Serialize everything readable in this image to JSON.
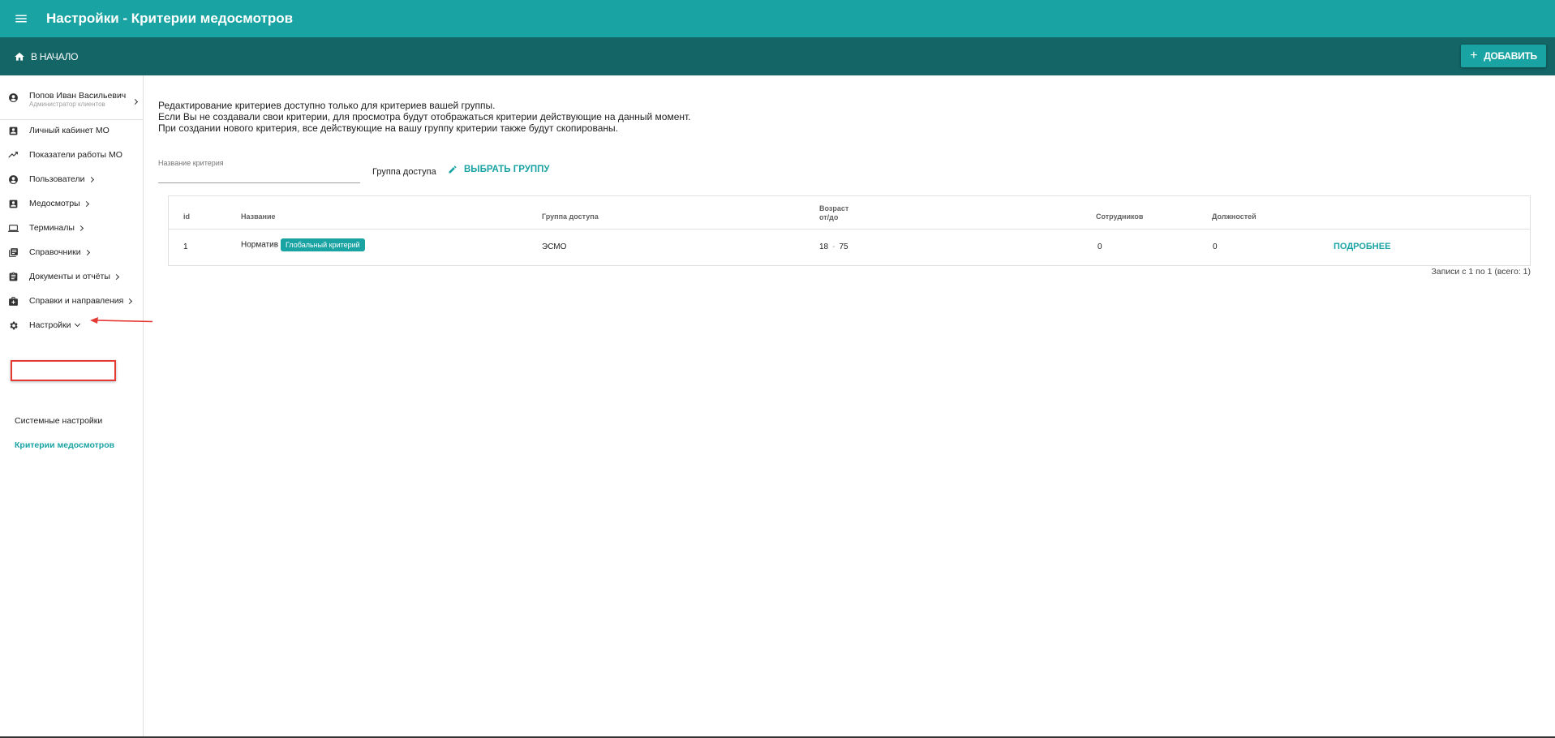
{
  "appbar": {
    "title": "Настройки - Критерии медосмотров"
  },
  "toolbar": {
    "home_label": "В НАЧАЛО",
    "add_label": "ДОБАВИТЬ"
  },
  "sidebar": {
    "user": {
      "name": "Попов Иван Васильевич",
      "role": "Администратор клиентов"
    },
    "items": [
      {
        "label": "Личный кабинет МО",
        "icon": "badge-icon"
      },
      {
        "label": "Показатели работы МО",
        "icon": "trending-icon"
      },
      {
        "label": "Пользователи",
        "icon": "account-icon"
      },
      {
        "label": "Медосмотры",
        "icon": "badge-icon"
      },
      {
        "label": "Терминалы",
        "icon": "laptop-icon"
      },
      {
        "label": "Справочники",
        "icon": "library-icon"
      },
      {
        "label": "Документы и отчёты",
        "icon": "clipboard-icon"
      },
      {
        "label": "Справки и направления",
        "icon": "medical-icon"
      },
      {
        "label": "Настройки",
        "icon": "gear-icon"
      }
    ],
    "sub_items": [
      {
        "label": "Системные настройки"
      },
      {
        "label": "Критерии медосмотров"
      }
    ]
  },
  "main": {
    "info_lines": [
      "Редактирование критериев доступно только для критериев вашей группы.",
      "Если Вы не создавали свои критерии, для просмотра будут отображаться критерии действующие на данный момент.",
      "При создании нового критерия, все действующие на вашу группу критерии также будут скопированы."
    ],
    "filter": {
      "label": "Название критерия",
      "value": ""
    },
    "group_label": "Группа доступа",
    "choose_group_label": "ВЫБРАТЬ ГРУППУ",
    "table": {
      "headers": {
        "id": "id",
        "name": "Название",
        "group": "Группа доступа",
        "age_line1": "Возраст",
        "age_line2": "от/до",
        "employees": "Сотрудников",
        "positions": "Должностей"
      },
      "rows": [
        {
          "id": "1",
          "name": "Норматив",
          "badge": "Глобальный критерий",
          "group": "ЭСМО",
          "age_from": "18",
          "age_sep": "-",
          "age_to": "75",
          "employees": "0",
          "positions": "0",
          "details": "ПОДРОБНЕЕ"
        }
      ]
    },
    "records": "Записи с 1 по 1 (всего: 1)"
  },
  "colors": {
    "primary": "#1aa3a3",
    "toolbar": "#136566",
    "annotation": "#e53935"
  }
}
